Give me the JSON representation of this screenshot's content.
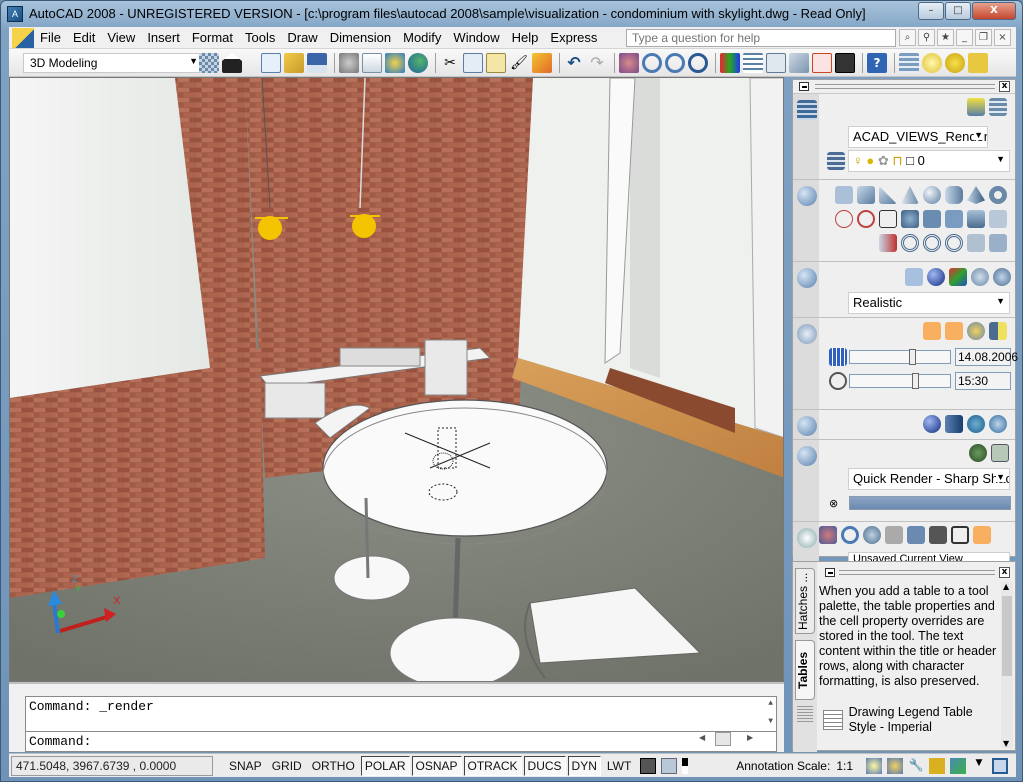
{
  "window": {
    "title": "AutoCAD 2008 - UNREGISTERED VERSION - [c:\\program files\\autocad 2008\\sample\\visualization - condominium with skylight.dwg - Read Only]",
    "app_icon_label": "A",
    "buttons": {
      "minimize": "–",
      "maximize": "□",
      "close": "X"
    }
  },
  "menubar": {
    "items": [
      "File",
      "Edit",
      "View",
      "Insert",
      "Format",
      "Tools",
      "Draw",
      "Dimension",
      "Modify",
      "Window",
      "Help",
      "Express"
    ],
    "help_placeholder": "Type a question for help",
    "doc_buttons": {
      "minimize": "_",
      "restore": "❐",
      "close": "×"
    }
  },
  "toolbar": {
    "workspace": "3D Modeling",
    "icons": [
      "workspace-settings",
      "my-workspace",
      "qnew",
      "open",
      "save",
      "plot",
      "plot-preview",
      "publish",
      "3d-dwf",
      "cut",
      "copy",
      "paste",
      "match-properties",
      "block-editor",
      "undo",
      "redo",
      "pan",
      "zoom-realtime",
      "zoom-window",
      "zoom-previous",
      "properties",
      "design-center",
      "tool-palettes",
      "sheet-set",
      "markup-set",
      "quickcalc",
      "help",
      "layer-manager",
      "layer-state"
    ]
  },
  "dashboard": {
    "layers": {
      "layer_state": "ACAD_VIEWS_Render ˈ",
      "current_layer": "0"
    },
    "visual_style": "Realistic",
    "lighting": {
      "date": "14.08.2006",
      "time": "15:30",
      "date_slider_fraction": 0.63,
      "time_slider_fraction": 0.66
    },
    "render": {
      "preset": "Quick Render - Sharp Shac",
      "progress_fraction": 1.0
    },
    "navigation": {
      "camera_view": "Unsaved Current View"
    }
  },
  "tool_palette": {
    "tabs": [
      "Hatches ...",
      "Tables"
    ],
    "active_tab": "Tables",
    "description": "When you add a table to a tool palette, the table properties and the cell property overrides are stored in the tool. The text content within the title or header rows, along with character formatting, is also preserved.",
    "tool_item": "Drawing Legend Table Style - Imperial"
  },
  "command": {
    "history": "Command:  _render",
    "prompt": "Command:"
  },
  "statusbar": {
    "coordinates": "471.5048,   3967.6739 , 0.0000",
    "toggles": [
      {
        "label": "SNAP",
        "on": false
      },
      {
        "label": "GRID",
        "on": false
      },
      {
        "label": "ORTHO",
        "on": false
      },
      {
        "label": "POLAR",
        "on": true
      },
      {
        "label": "OSNAP",
        "on": true
      },
      {
        "label": "OTRACK",
        "on": true
      },
      {
        "label": "DUCS",
        "on": true
      },
      {
        "label": "DYN",
        "on": true
      },
      {
        "label": "LWT",
        "on": false
      }
    ],
    "annotation_scale_label": "Annotation Scale:",
    "annotation_scale_value": "1:1"
  },
  "viewport": {
    "ucs_labels": {
      "x": "X",
      "y": "Y",
      "z": "Z"
    }
  },
  "colors": {
    "brick": "#a55a45",
    "floor": "#7d8176",
    "wood": "#c8914e",
    "lamp": "#f5c400",
    "active_orange": "#f8b060"
  }
}
